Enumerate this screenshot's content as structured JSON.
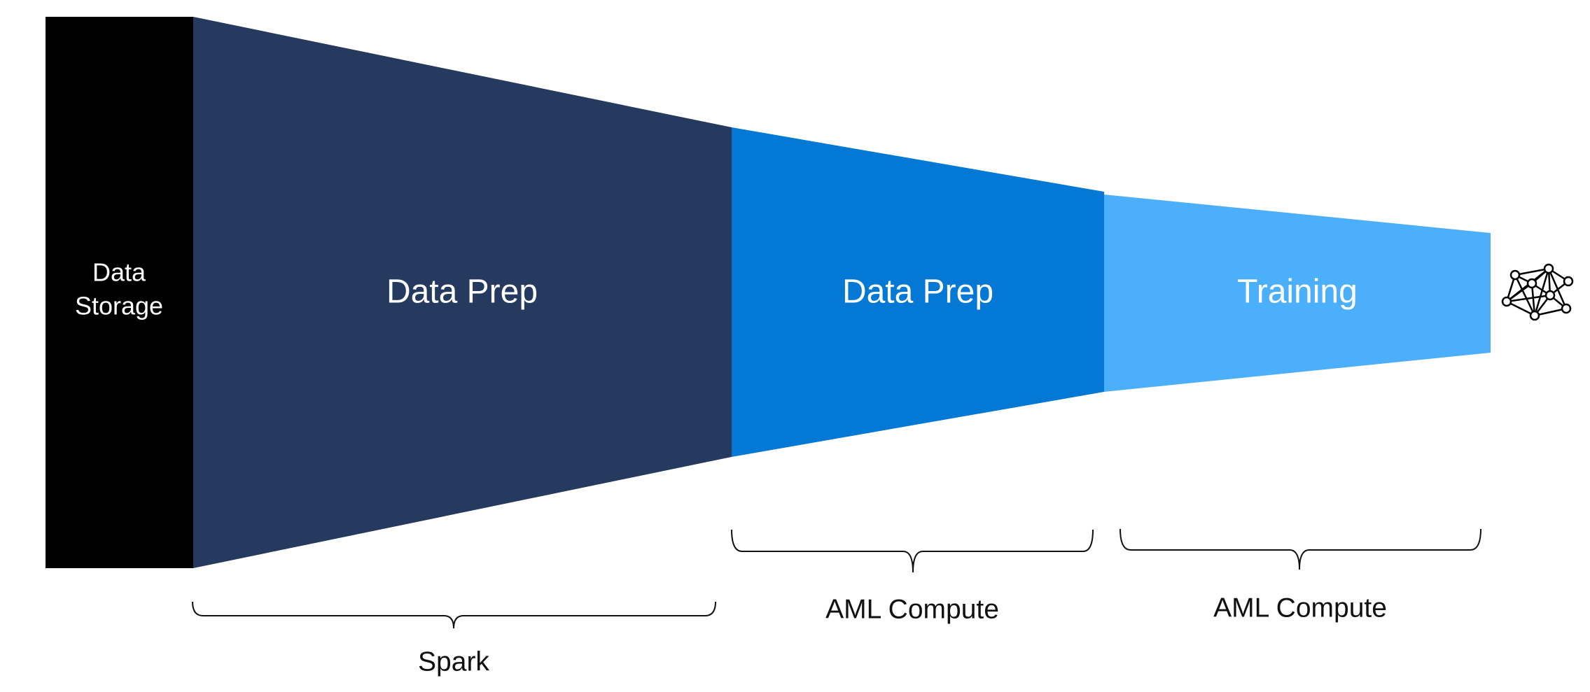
{
  "storage": {
    "label_line1": "Data",
    "label_line2": "Storage",
    "color": "#000000"
  },
  "stages": [
    {
      "label": "Data Prep",
      "color": "#253A5E"
    },
    {
      "label": "Data Prep",
      "color": "#0378D4"
    },
    {
      "label": "Training",
      "color": "#4CAFFC"
    }
  ],
  "compute": [
    {
      "label": "Spark"
    },
    {
      "label": "AML Compute"
    },
    {
      "label": "AML Compute"
    }
  ],
  "model": {
    "icon": "neural-network-icon"
  }
}
